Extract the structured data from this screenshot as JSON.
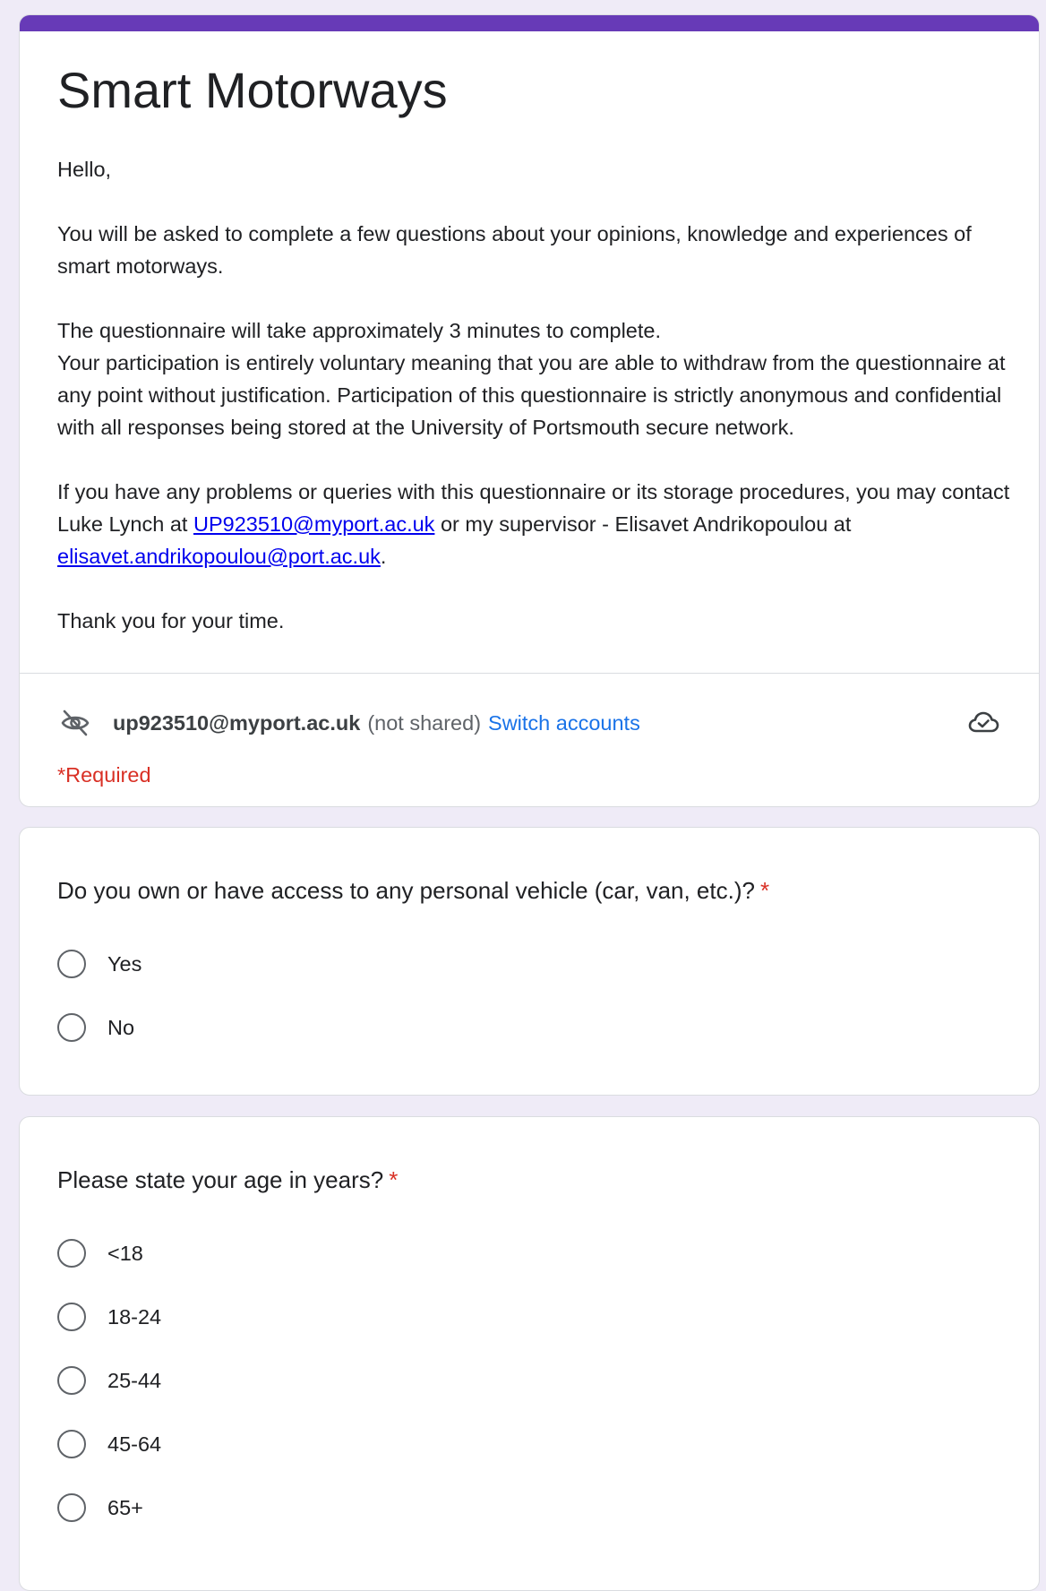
{
  "form": {
    "title": "Smart Motorways",
    "accent_color": "#673ab7",
    "description": {
      "greeting": "Hello,",
      "intro": "You will be asked to complete a few questions about your opinions, knowledge and experiences of smart motorways.",
      "duration": "The questionnaire will take approximately 3 minutes to complete.",
      "participation": "Your participation is entirely voluntary meaning that you are able to withdraw from the questionnaire at any point without justification. Participation of this questionnaire is strictly anonymous and confidential with all responses being stored at the University of Portsmouth secure network.",
      "contact_part1": "If you have any problems or queries with this questionnaire or its storage procedures, you may contact Luke Lynch at ",
      "contact_email1": "UP923510@myport.ac.uk",
      "contact_part2": " or my supervisor - Elisavet Andrikopoulou at ",
      "contact_email2": "elisavet.andrikopoulou@port.ac.uk",
      "contact_part3": ".",
      "thanks": "Thank you for your time."
    },
    "account": {
      "email": "up923510@myport.ac.uk",
      "not_shared": "(not shared)",
      "switch_label": "Switch accounts",
      "visibility_icon": "eye-off-icon",
      "save_icon": "cloud-check-icon"
    },
    "required_note": "*Required"
  },
  "questions": [
    {
      "title": "Do you own or have access to any personal vehicle (car, van, etc.)?",
      "required_mark": "*",
      "options": [
        "Yes",
        "No"
      ]
    },
    {
      "title": "Please state your age in years?",
      "required_mark": "*",
      "options": [
        "<18",
        "18-24",
        "25-44",
        "45-64",
        "65+"
      ]
    }
  ]
}
